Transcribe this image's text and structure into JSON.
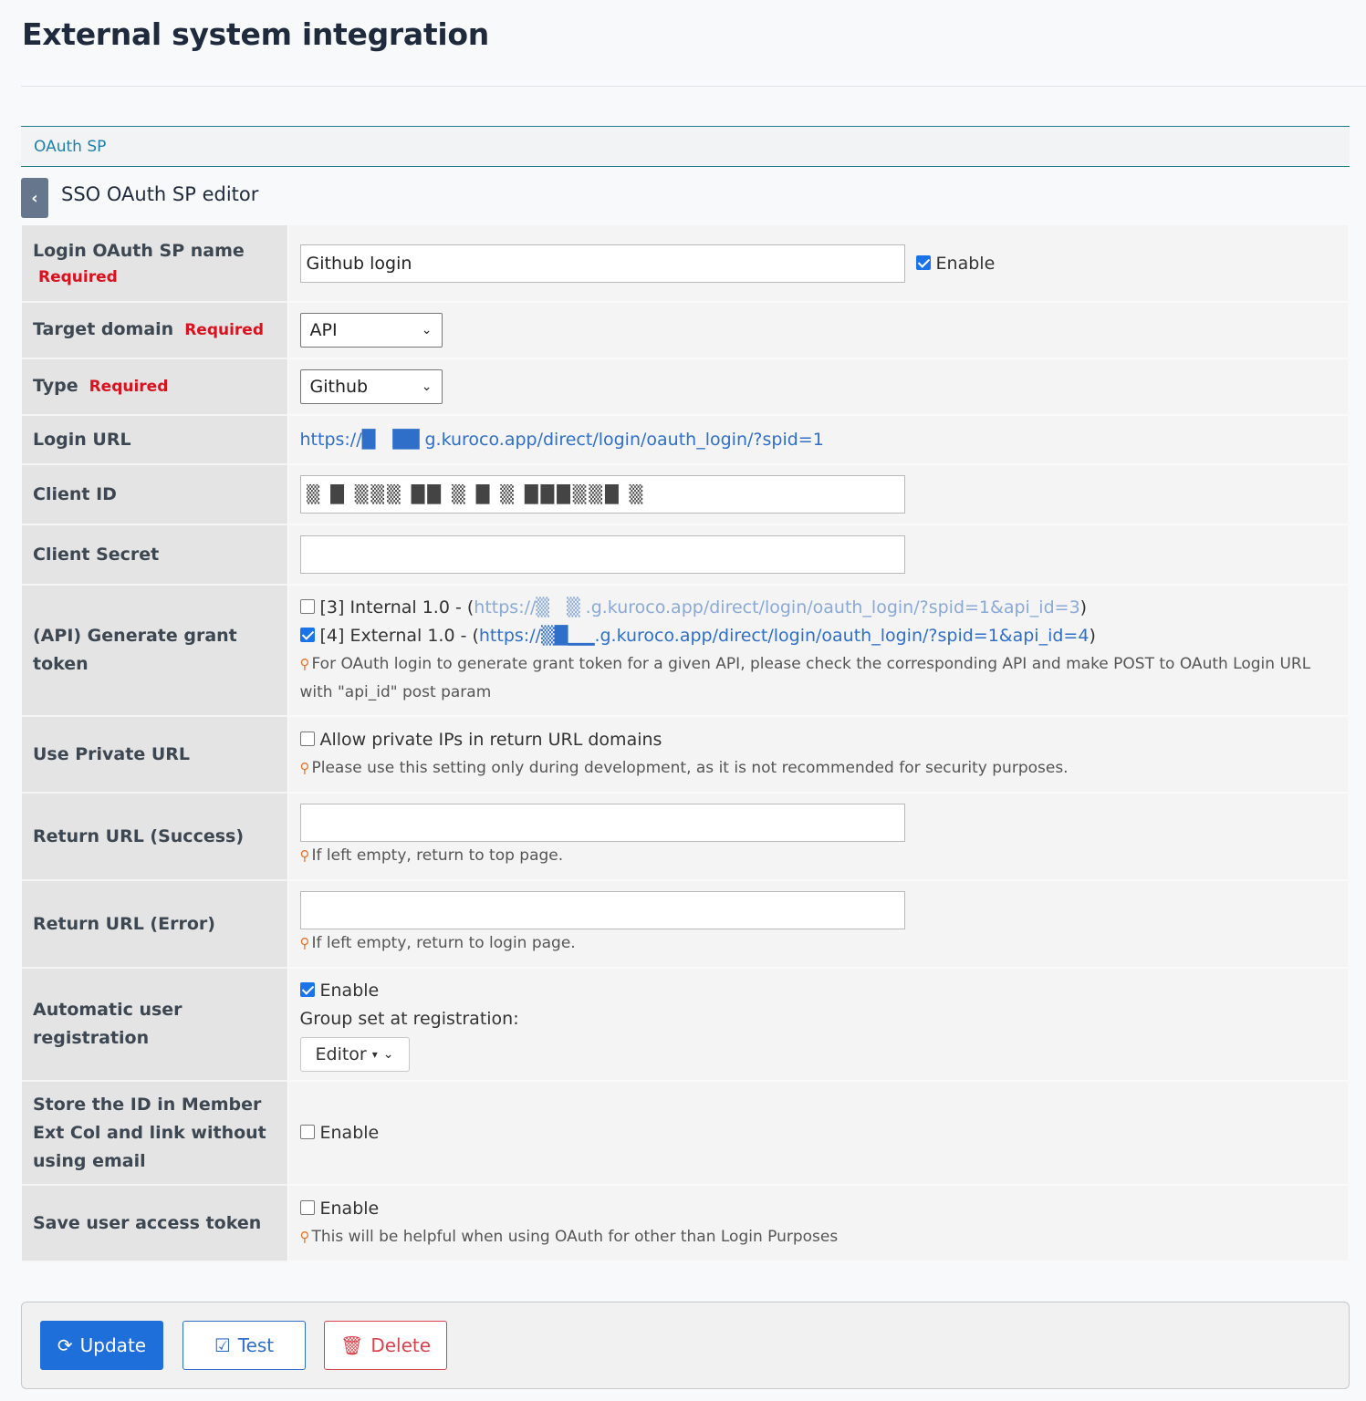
{
  "page": {
    "title": "External system integration"
  },
  "tabs": {
    "oauth_sp": "OAuth SP"
  },
  "editor": {
    "back_icon": "chevron-left-icon",
    "title": "SSO OAuth SP editor"
  },
  "labels": {
    "required": "Required",
    "enable": "Enable"
  },
  "fields": {
    "sp_name": {
      "label": "Login OAuth SP name",
      "value": "Github login",
      "enabled": true
    },
    "target_domain": {
      "label": "Target domain",
      "value": "API"
    },
    "type": {
      "label": "Type",
      "value": "Github"
    },
    "login_url": {
      "label": "Login URL",
      "value": "https://█ ██ g.kuroco.app/direct/login/oauth_login/?spid=1"
    },
    "client_id": {
      "label": "Client ID",
      "value": "▒ █ ▒▒▒ ██ ▒ █ ▒ ███▒▒█ ▒"
    },
    "client_secret": {
      "label": "Client Secret",
      "value": ""
    },
    "grant_token": {
      "label": "(API) Generate grant token",
      "options": [
        {
          "prefix": "[3] Internal 1.0 - (",
          "url": "https://▒ ▒ .g.kuroco.app/direct/login/oauth_login/?spid=1&api_id=3",
          "suffix": ")",
          "checked": false
        },
        {
          "prefix": "[4] External 1.0 - (",
          "url": "https://▒█▁▁.g.kuroco.app/direct/login/oauth_login/?spid=1&api_id=4",
          "suffix": ")",
          "checked": true
        }
      ],
      "hint": "For OAuth login to generate grant token for a given API, please check the corresponding API and make POST to OAuth Login URL with \"api_id\" post param"
    },
    "private_url": {
      "label": "Use Private URL",
      "option": "Allow private IPs in return URL domains",
      "checked": false,
      "hint": "Please use this setting only during development, as it is not recommended for security purposes."
    },
    "return_success": {
      "label": "Return URL (Success)",
      "value": "",
      "hint": "If left empty, return to top page."
    },
    "return_error": {
      "label": "Return URL (Error)",
      "value": "",
      "hint": "If left empty, return to login page."
    },
    "auto_registration": {
      "label": "Automatic user registration",
      "checked": true,
      "group_label": "Group set at registration:",
      "group_value": "Editor"
    },
    "store_id": {
      "label": "Store the ID in Member Ext Col and link without using email",
      "checked": false
    },
    "save_token": {
      "label": "Save user access token",
      "checked": false,
      "hint": "This will be helpful when using OAuth for other than Login Purposes"
    }
  },
  "actions": {
    "update": "Update",
    "test": "Test",
    "delete": "Delete"
  },
  "colors": {
    "primary": "#1f6fdb",
    "danger": "#d9434d",
    "required": "#d9121f",
    "tab_border": "#1b7a85"
  }
}
